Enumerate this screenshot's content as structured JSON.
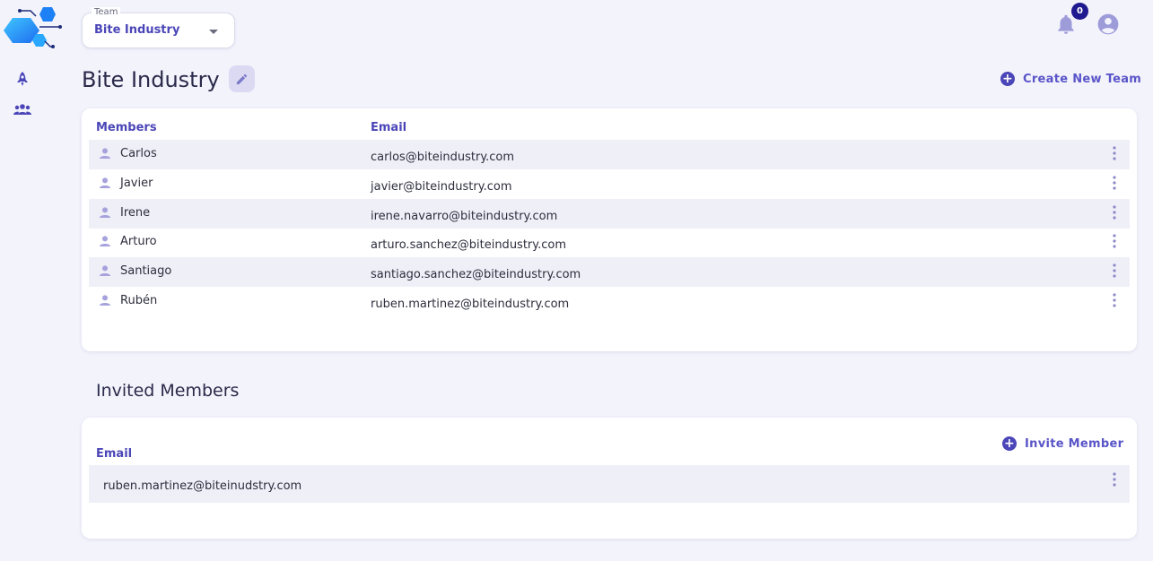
{
  "header": {
    "team_select": {
      "caption": "Team",
      "value": "Bite Industry"
    },
    "notifications_count": "0"
  },
  "page": {
    "title": "Bite Industry",
    "create_team_label": "Create New Team"
  },
  "members": {
    "columns": {
      "members": "Members",
      "email": "Email"
    },
    "rows": [
      {
        "name": "Carlos",
        "email": "carlos@biteindustry.com"
      },
      {
        "name": "Javier",
        "email": "javier@biteindustry.com"
      },
      {
        "name": "Irene",
        "email": "irene.navarro@biteindustry.com"
      },
      {
        "name": "Arturo",
        "email": "arturo.sanchez@biteindustry.com"
      },
      {
        "name": "Santiago",
        "email": "santiago.sanchez@biteindustry.com"
      },
      {
        "name": "Rubén",
        "email": "ruben.martinez@biteindustry.com"
      }
    ]
  },
  "invited": {
    "title": "Invited Members",
    "column_email": "Email",
    "invite_label": "Invite Member",
    "rows": [
      {
        "email": "ruben.martinez@biteinudstry.com"
      }
    ]
  },
  "colors": {
    "accent": "#4b46b8",
    "background": "#f3f3fc",
    "row_alt": "#efeff8",
    "badge": "#1f1a8f"
  },
  "icons": {
    "logo": "hexagon-circuit-logo",
    "rail": [
      "rocket-icon",
      "group-icon"
    ],
    "header": [
      "bell-icon",
      "account-circle-icon"
    ],
    "edit": "pencil-icon",
    "row": [
      "person-icon",
      "kebab-menu-icon"
    ]
  }
}
